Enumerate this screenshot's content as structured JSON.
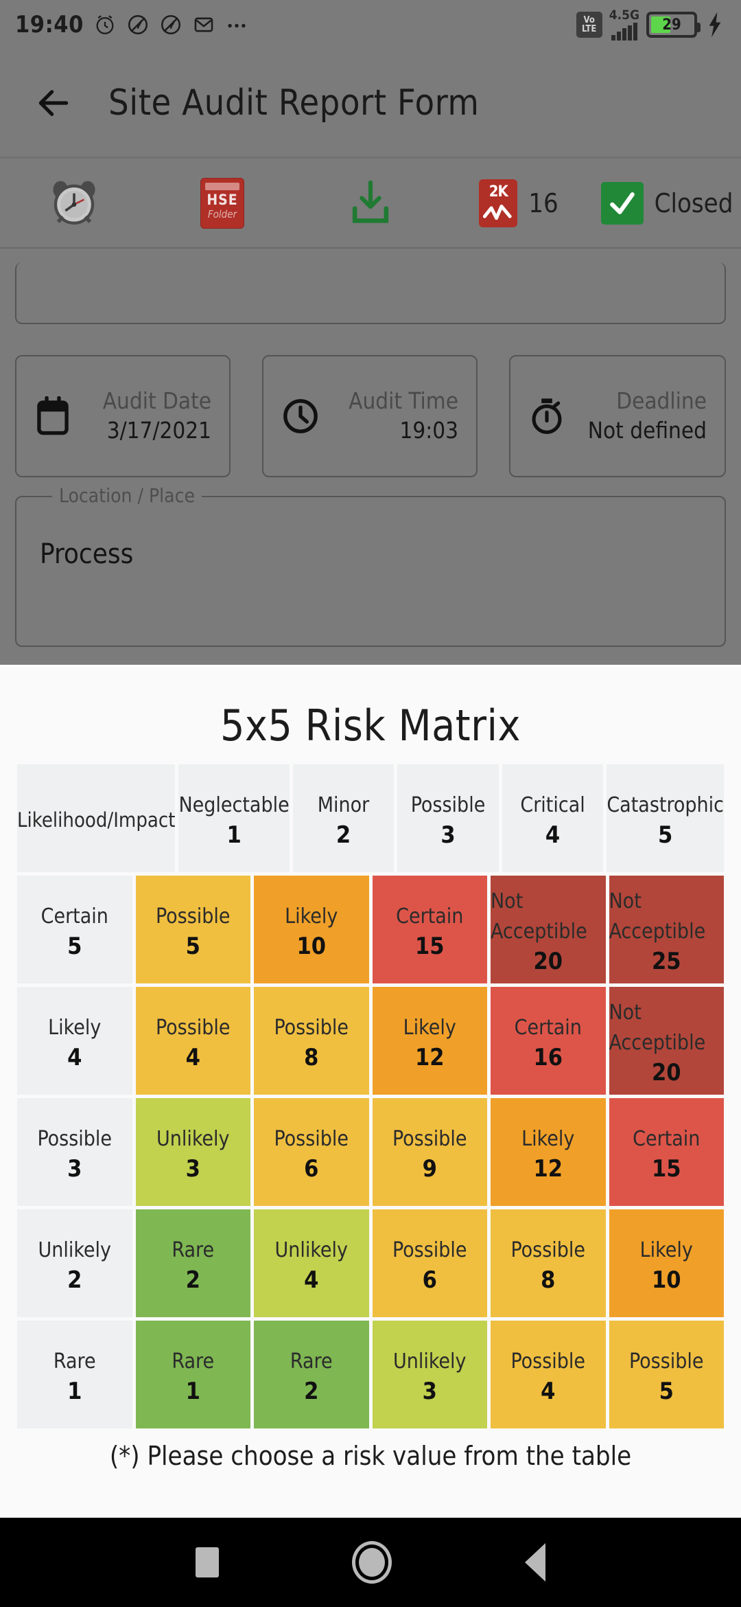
{
  "statusbar": {
    "time": "19:40",
    "icons": [
      "alarm-icon",
      "do-not-disturb-icon",
      "do-not-disturb-icon",
      "mail-icon",
      "more-icon"
    ],
    "volte_top": "Vo",
    "volte_bottom": "LTE",
    "network": "4.5G",
    "battery_percent": "29",
    "charging_icon": "bolt-icon"
  },
  "appbar": {
    "back_icon": "back-arrow-icon",
    "title": "Site Audit Report Form"
  },
  "toolbar": {
    "items": [
      {
        "icon": "alarm-clock-icon",
        "label": ""
      },
      {
        "icon": "hse-folder-icon",
        "label": "",
        "badge_top": "HSE",
        "badge_bottom": "Folder"
      },
      {
        "icon": "download-icon",
        "label": ""
      },
      {
        "icon": "risk-chart-icon",
        "label": "16",
        "badge_top": "2K"
      },
      {
        "icon": "check-icon",
        "label": "Closed"
      }
    ]
  },
  "form": {
    "audit_date": {
      "icon": "calendar-icon",
      "label": "Audit Date",
      "value": "3/17/2021"
    },
    "audit_time": {
      "icon": "clock-icon",
      "label": "Audit Time",
      "value": "19:03"
    },
    "deadline": {
      "icon": "stopwatch-icon",
      "label": "Deadline",
      "value": "Not defined"
    },
    "location": {
      "legend": "Location / Place",
      "value": "Process"
    }
  },
  "sheet": {
    "title": "5x5 Risk Matrix",
    "hint": "(*) Please choose a risk value from the table"
  },
  "colors": {
    "header_bg": "#eef0f1",
    "green": "#7fb753",
    "light_green": "#bed css",
    "yellow": "#f0bf40",
    "orange": "#f0a028",
    "red": "#dd5549",
    "dark_red": "#b2463a",
    "sheet_bg": "#fafafa",
    "backdrop": "#7b7b7b"
  },
  "chart_data": {
    "type": "heatmap",
    "title": "5x5 Risk Matrix",
    "corner_label": "Likelihood/Impact",
    "xlabel": "Impact",
    "ylabel": "Likelihood",
    "columns": [
      {
        "label": "Neglectable",
        "value": 1
      },
      {
        "label": "Minor",
        "value": 2
      },
      {
        "label": "Possible",
        "value": 3
      },
      {
        "label": "Critical",
        "value": 4
      },
      {
        "label": "Catastrophic",
        "value": 5
      }
    ],
    "rows": [
      {
        "label": "Certain",
        "value": 5,
        "cells": [
          {
            "label": "Possible",
            "value": 5,
            "color": "#f0bf40"
          },
          {
            "label": "Likely",
            "value": 10,
            "color": "#f0a028"
          },
          {
            "label": "Certain",
            "value": 15,
            "color": "#dd5549"
          },
          {
            "label": "Not Acceptible",
            "value": 20,
            "color": "#b2463a"
          },
          {
            "label": "Not Acceptible",
            "value": 25,
            "color": "#b2463a"
          }
        ]
      },
      {
        "label": "Likely",
        "value": 4,
        "cells": [
          {
            "label": "Possible",
            "value": 4,
            "color": "#f0bf40"
          },
          {
            "label": "Possible",
            "value": 8,
            "color": "#f0bf40"
          },
          {
            "label": "Likely",
            "value": 12,
            "color": "#f0a028"
          },
          {
            "label": "Certain",
            "value": 16,
            "color": "#dd5549"
          },
          {
            "label": "Not Acceptible",
            "value": 20,
            "color": "#b2463a"
          }
        ]
      },
      {
        "label": "Possible",
        "value": 3,
        "cells": [
          {
            "label": "Unlikely",
            "value": 3,
            "color": "#c2d14e"
          },
          {
            "label": "Possible",
            "value": 6,
            "color": "#f0bf40"
          },
          {
            "label": "Possible",
            "value": 9,
            "color": "#f0bf40"
          },
          {
            "label": "Likely",
            "value": 12,
            "color": "#f0a028"
          },
          {
            "label": "Certain",
            "value": 15,
            "color": "#dd5549"
          }
        ]
      },
      {
        "label": "Unlikely",
        "value": 2,
        "cells": [
          {
            "label": "Rare",
            "value": 2,
            "color": "#7fb753"
          },
          {
            "label": "Unlikely",
            "value": 4,
            "color": "#c2d14e"
          },
          {
            "label": "Possible",
            "value": 6,
            "color": "#f0bf40"
          },
          {
            "label": "Possible",
            "value": 8,
            "color": "#f0bf40"
          },
          {
            "label": "Likely",
            "value": 10,
            "color": "#f0a028"
          }
        ]
      },
      {
        "label": "Rare",
        "value": 1,
        "cells": [
          {
            "label": "Rare",
            "value": 1,
            "color": "#7fb753"
          },
          {
            "label": "Rare",
            "value": 2,
            "color": "#7fb753"
          },
          {
            "label": "Unlikely",
            "value": 3,
            "color": "#c2d14e"
          },
          {
            "label": "Possible",
            "value": 4,
            "color": "#f0bf40"
          },
          {
            "label": "Possible",
            "value": 5,
            "color": "#f0bf40"
          }
        ]
      }
    ]
  },
  "navbar": {
    "recents": "recents-icon",
    "home": "home-icon",
    "back": "back-icon"
  }
}
